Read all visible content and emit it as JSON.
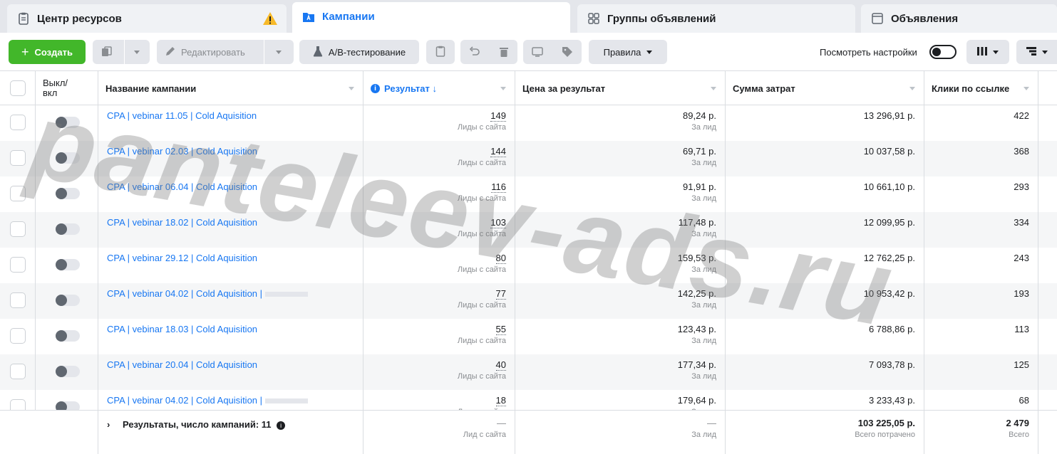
{
  "tabs": [
    {
      "label": "Центр ресурсов"
    },
    {
      "label": "Кампании"
    },
    {
      "label": "Группы объявлений"
    },
    {
      "label": "Объявления"
    }
  ],
  "toolbar": {
    "create_label": "Создать",
    "edit_label": "Редактировать",
    "ab_label": "A/B-тестирование",
    "rules_label": "Правила",
    "view_settings_label": "Посмотреть настройки"
  },
  "header": {
    "onoff_label_1": "Выкл/",
    "onoff_label_2": "вкл",
    "name_col": "Название кампании",
    "result_col": "Результат ↓",
    "cpr_col": "Цена за результат",
    "spent_col": "Сумма затрат",
    "clicks_col": "Клики по ссылке"
  },
  "rows": [
    {
      "name": "CPA | vebinar 11.05 | Cold Aquisition",
      "result": "149",
      "result_sub": "Лиды с сайта",
      "cpr": "89,24 р.",
      "cpr_sub": "За лид",
      "spent": "13 296,91 р.",
      "clicks": "422"
    },
    {
      "name": "CPA | vebinar 02.03 | Cold Aquisition",
      "result": "144",
      "result_sub": "Лиды с сайта",
      "cpr": "69,71 р.",
      "cpr_sub": "За лид",
      "spent": "10 037,58 р.",
      "clicks": "368"
    },
    {
      "name": "CPA | vebinar 06.04 | Cold Aquisition",
      "result": "116",
      "result_sub": "Лиды с сайта",
      "cpr": "91,91 р.",
      "cpr_sub": "За лид",
      "spent": "10 661,10 р.",
      "clicks": "293"
    },
    {
      "name": "CPA | vebinar 18.02 | Cold Aquisition",
      "result": "103",
      "result_sub": "Лиды с сайта",
      "cpr": "117,48 р.",
      "cpr_sub": "За лид",
      "spent": "12 099,95 р.",
      "clicks": "334"
    },
    {
      "name": "CPA | vebinar 29.12 | Cold Aquisition",
      "result": "80",
      "result_sub": "Лиды с сайта",
      "cpr": "159,53 р.",
      "cpr_sub": "За лид",
      "spent": "12 762,25 р.",
      "clicks": "243"
    },
    {
      "name": "CPA | vebinar 04.02 | Cold Aquisition |",
      "result": "77",
      "result_sub": "Лиды с сайта",
      "cpr": "142,25 р.",
      "cpr_sub": "За лид",
      "spent": "10 953,42 р.",
      "clicks": "193"
    },
    {
      "name": "CPA | vebinar 18.03 | Cold Aquisition",
      "result": "55",
      "result_sub": "Лиды с сайта",
      "cpr": "123,43 р.",
      "cpr_sub": "За лид",
      "spent": "6 788,86 р.",
      "clicks": "113"
    },
    {
      "name": "CPA | vebinar 20.04 | Cold Aquisition",
      "result": "40",
      "result_sub": "Лиды с сайта",
      "cpr": "177,34 р.",
      "cpr_sub": "За лид",
      "spent": "7 093,78 р.",
      "clicks": "125"
    },
    {
      "name": "CPA | vebinar 04.02 | Cold Aquisition |",
      "result": "18",
      "result_sub": "Лиды с сайта",
      "cpr": "179,64 р.",
      "cpr_sub": "За лид",
      "spent": "3 233,43 р.",
      "clicks": "68"
    }
  ],
  "footer": {
    "summary": "Результаты, число кампаний: 11",
    "result_value": "—",
    "result_sub": "Лид с сайта",
    "cpr_value": "—",
    "cpr_sub": "За лид",
    "spent_value": "103 225,05 р.",
    "spent_sub": "Всего потрачено",
    "clicks_value": "2 479",
    "clicks_sub": "Всего"
  },
  "watermark": "panteleev-ads.ru",
  "colors": {
    "accent": "#1877f2",
    "create": "#42b72a",
    "warning": "#f7b928"
  }
}
